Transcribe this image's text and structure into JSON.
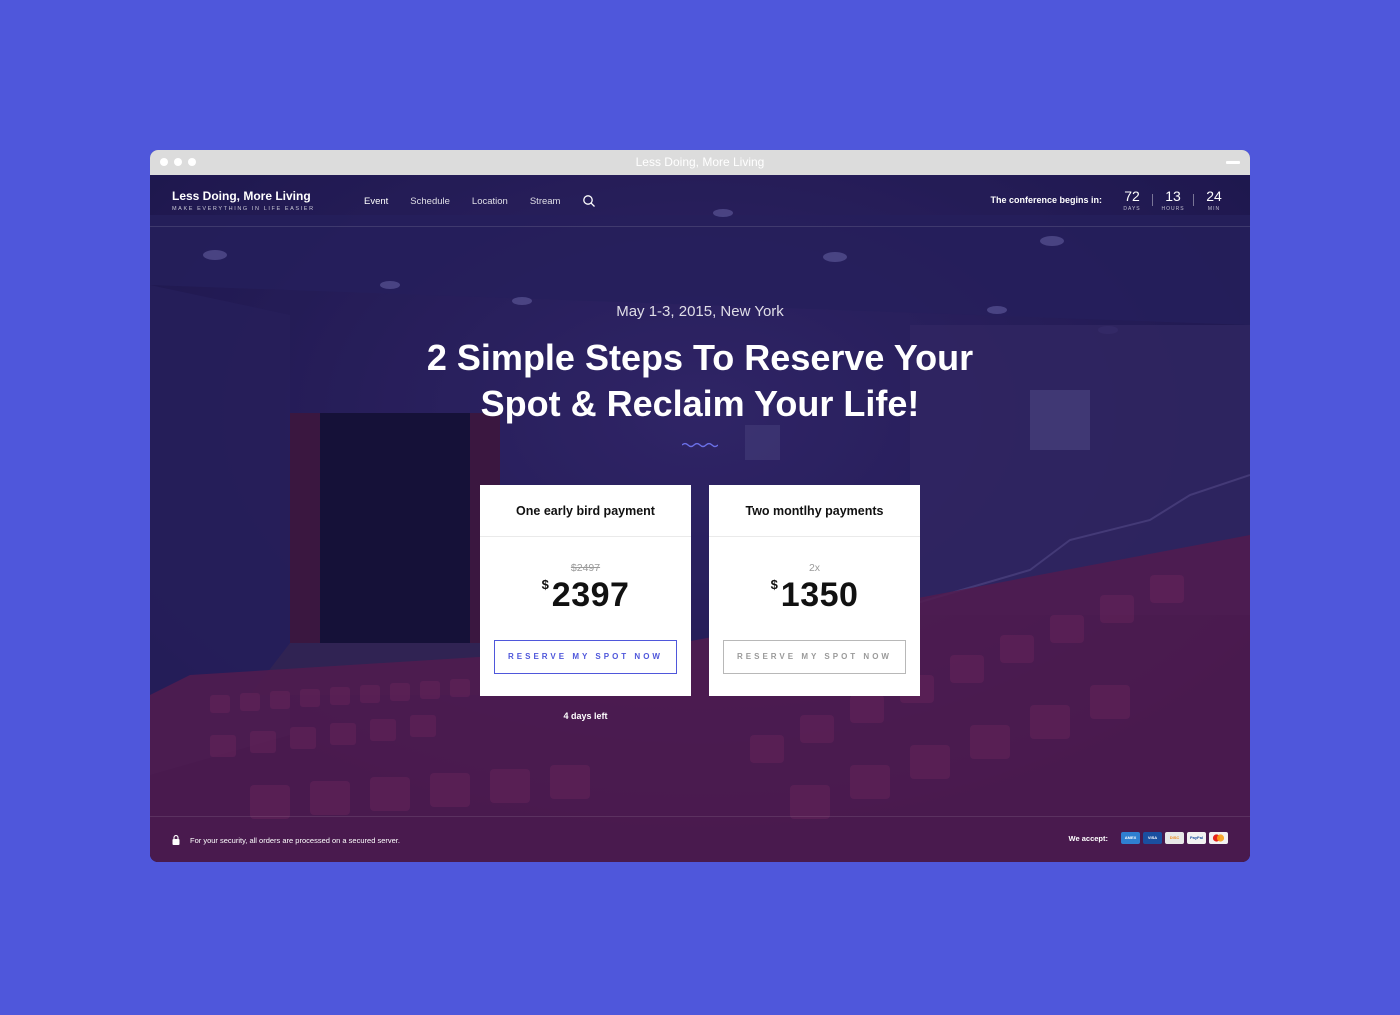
{
  "window": {
    "title": "Less Doing, More Living"
  },
  "brand": {
    "name": "Less Doing, More Living",
    "tagline": "MAKE EVERYTHING IN LIFE EASIER"
  },
  "nav": {
    "items": [
      {
        "label": "Event",
        "active": true
      },
      {
        "label": "Schedule"
      },
      {
        "label": "Location"
      },
      {
        "label": "Stream"
      }
    ],
    "search_icon": "search-icon"
  },
  "countdown": {
    "label": "The conference begins in:",
    "units": [
      {
        "value": "72",
        "label": "DAYS"
      },
      {
        "value": "13",
        "label": "HOURS"
      },
      {
        "value": "24",
        "label": "MIN"
      }
    ]
  },
  "hero": {
    "date": "May 1-3, 2015, New York",
    "headline_line1": "2 Simple Steps To Reserve Your",
    "headline_line2": "Spot & Reclaim Your Life!"
  },
  "cards": [
    {
      "title": "One early bird payment",
      "pre": "$2497",
      "currency": "$",
      "price": "2397",
      "cta": "RESERVE MY SPOT NOW",
      "note": "4 days left"
    },
    {
      "title": "Two montlhy payments",
      "pre": "2x",
      "currency": "$",
      "price": "1350",
      "cta": "RESERVE MY SPOT NOW"
    }
  ],
  "footer": {
    "secure_text": "For your security, all orders are processed on a secured server.",
    "accept_label": "We accept:",
    "payment_methods": [
      {
        "name": "AMEX",
        "color": "#2f7fd1"
      },
      {
        "name": "VISA",
        "color": "#1a4fa0"
      },
      {
        "name": "DISCOVER",
        "color": "#e8e8e8"
      },
      {
        "name": "PayPal",
        "color": "#f2f2f2"
      },
      {
        "name": "MasterCard",
        "color": "#f3f3f3"
      }
    ]
  },
  "colors": {
    "background": "#4f57db",
    "accent": "#4f57db"
  }
}
